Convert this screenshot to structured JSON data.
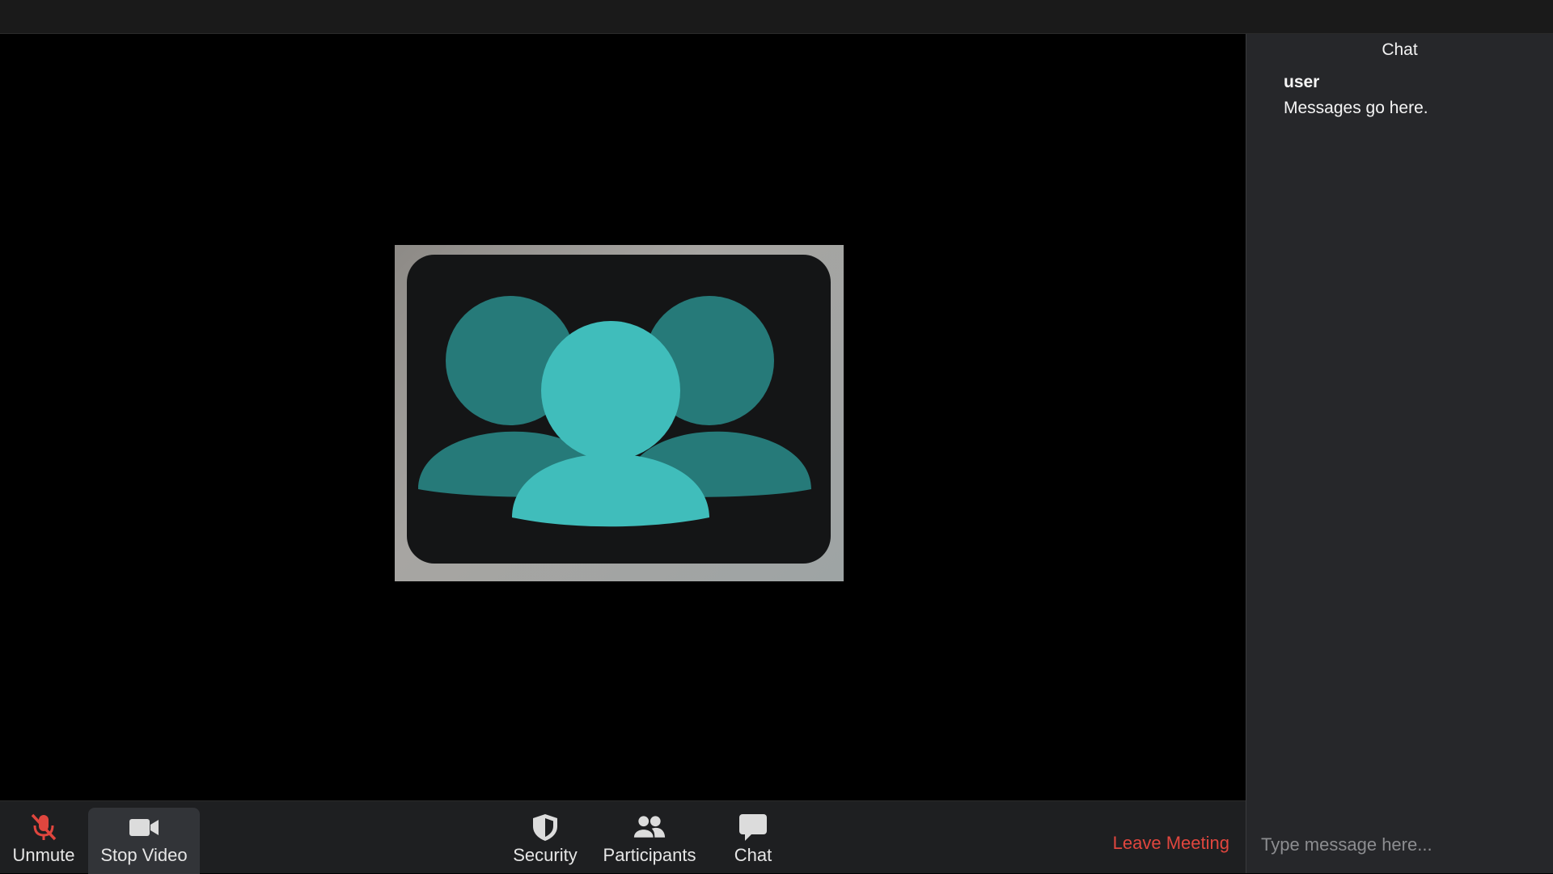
{
  "toolbar": {
    "unmute_label": "Unmute",
    "stop_video_label": "Stop Video",
    "security_label": "Security",
    "participants_label": "Participants",
    "chat_label": "Chat",
    "leave_label": "Leave Meeting"
  },
  "chat": {
    "title": "Chat",
    "messages": [
      {
        "author": "user",
        "text": "Messages go here."
      }
    ],
    "input_placeholder": "Type message here..."
  },
  "colors": {
    "leave": "#e0463e",
    "muted_mic": "#e0463e",
    "avatar_front": "#40bdbb",
    "avatar_back": "#267a79"
  },
  "icons": {
    "unmute": "muted-microphone-icon",
    "stop_video": "video-camera-icon",
    "security": "shield-icon",
    "participants": "people-icon",
    "chat": "chat-bubble-icon"
  }
}
